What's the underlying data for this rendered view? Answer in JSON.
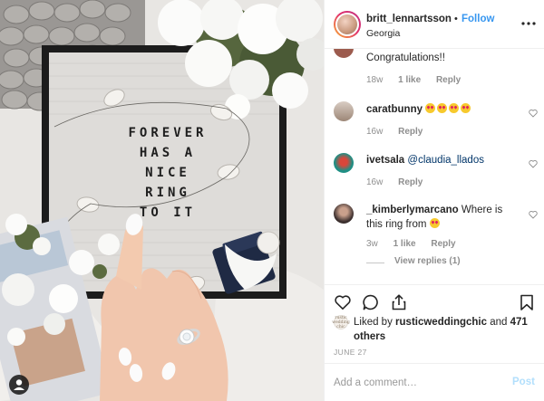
{
  "post": {
    "photo_alt": "",
    "board_lines": [
      "FOREVER",
      "HAS A",
      "NICE",
      "RING",
      "TO IT"
    ],
    "photo_user_icon": "person-icon"
  },
  "header": {
    "username": "britt_lennartsson",
    "separator": "•",
    "follow_label": "Follow",
    "location": "Georgia",
    "more_icon": "more-horizontal-icon"
  },
  "comments": [
    {
      "username": "",
      "text": "Congratulations!!",
      "time": "18w",
      "likes": "1 like",
      "reply_label": "Reply",
      "avatar_color": "#9c5b4e"
    },
    {
      "username": "caratbunny",
      "text": "",
      "emoji_count": 4,
      "emoji": "heart-eyes-emoji",
      "time": "16w",
      "reply_label": "Reply",
      "avatar_color": "#b9a79b"
    },
    {
      "username": "ivetsala",
      "mention": "@claudia_llados",
      "time": "16w",
      "reply_label": "Reply",
      "avatar_color": "#1f8f84"
    },
    {
      "username": "_kimberlymarcano",
      "text": "Where is this ring from",
      "emoji_count": 1,
      "emoji": "heart-eyes-emoji",
      "time": "3w",
      "likes": "1 like",
      "reply_label": "Reply",
      "replies_label": "View replies (1)",
      "avatar_color": "#5a4a48"
    }
  ],
  "actions": {
    "like_icon": "heart-icon",
    "comment_icon": "comment-icon",
    "share_icon": "share-icon",
    "save_icon": "bookmark-icon"
  },
  "likes": {
    "avatar_text": "rustic wedding chic",
    "prefix": "Liked by",
    "user": "rusticweddingchic",
    "and": "and",
    "others": "471 others"
  },
  "date": "JUNE 27",
  "add_comment": {
    "placeholder": "Add a comment…",
    "post_label": "Post"
  },
  "colors": {
    "accent": "#3897f0",
    "post_disabled": "#b2dffc",
    "gray_text": "#8e8e8e",
    "divider": "#efefef"
  }
}
